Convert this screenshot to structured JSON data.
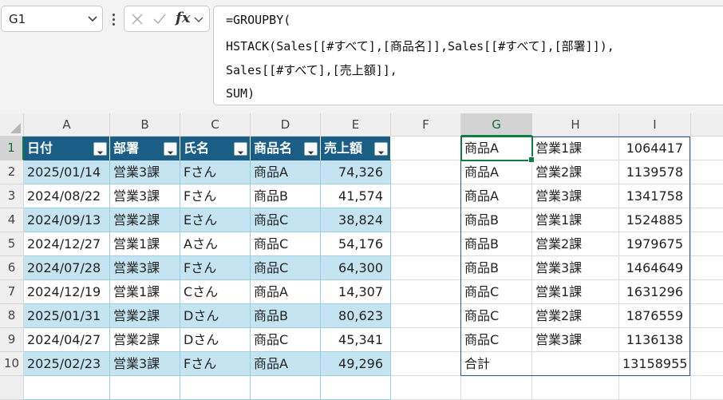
{
  "name_box": {
    "value": "G1"
  },
  "formula_bar": {
    "fx_label": "fx",
    "lines": [
      "=GROUPBY(",
      "HSTACK(Sales[[#すべて],[商品名]],Sales[[#すべて],[部署]]),",
      "Sales[[#すべて],[売上額]],",
      "SUM)"
    ]
  },
  "columns": [
    "A",
    "B",
    "C",
    "D",
    "E",
    "F",
    "G",
    "H",
    "I"
  ],
  "rows": [
    "1",
    "2",
    "3",
    "4",
    "5",
    "6",
    "7",
    "8",
    "9",
    "10",
    ""
  ],
  "table": {
    "headers": [
      "日付",
      "部署",
      "氏名",
      "商品名",
      "売上額"
    ],
    "rows": [
      [
        "2025/01/14",
        "営業3課",
        "Fさん",
        "商品A",
        "74,326"
      ],
      [
        "2024/08/22",
        "営業3課",
        "Fさん",
        "商品B",
        "41,574"
      ],
      [
        "2024/09/13",
        "営業2課",
        "Eさん",
        "商品C",
        "38,824"
      ],
      [
        "2024/12/27",
        "営業1課",
        "Aさん",
        "商品C",
        "54,176"
      ],
      [
        "2024/07/28",
        "営業3課",
        "Fさん",
        "商品C",
        "64,300"
      ],
      [
        "2024/12/19",
        "営業1課",
        "Cさん",
        "商品A",
        "14,307"
      ],
      [
        "2025/01/31",
        "営業2課",
        "Dさん",
        "商品B",
        "80,623"
      ],
      [
        "2024/04/27",
        "営業2課",
        "Dさん",
        "商品C",
        "45,341"
      ],
      [
        "2025/02/23",
        "営業3課",
        "Fさん",
        "商品A",
        "49,296"
      ]
    ]
  },
  "groupby_result": [
    [
      "商品A",
      "営業1課",
      "1064417"
    ],
    [
      "商品A",
      "営業2課",
      "1139578"
    ],
    [
      "商品A",
      "営業3課",
      "1341758"
    ],
    [
      "商品B",
      "営業1課",
      "1524885"
    ],
    [
      "商品B",
      "営業2課",
      "1979675"
    ],
    [
      "商品B",
      "営業3課",
      "1464649"
    ],
    [
      "商品C",
      "営業1課",
      "1631296"
    ],
    [
      "商品C",
      "営業2課",
      "1876559"
    ],
    [
      "商品C",
      "営業3課",
      "1136138"
    ],
    [
      "合計",
      "",
      "13158955"
    ]
  ],
  "colors": {
    "table_header": "#1b5e85",
    "band_row": "#c4e4f2",
    "selection": "#107c41",
    "spill_border": "#2f5597"
  }
}
